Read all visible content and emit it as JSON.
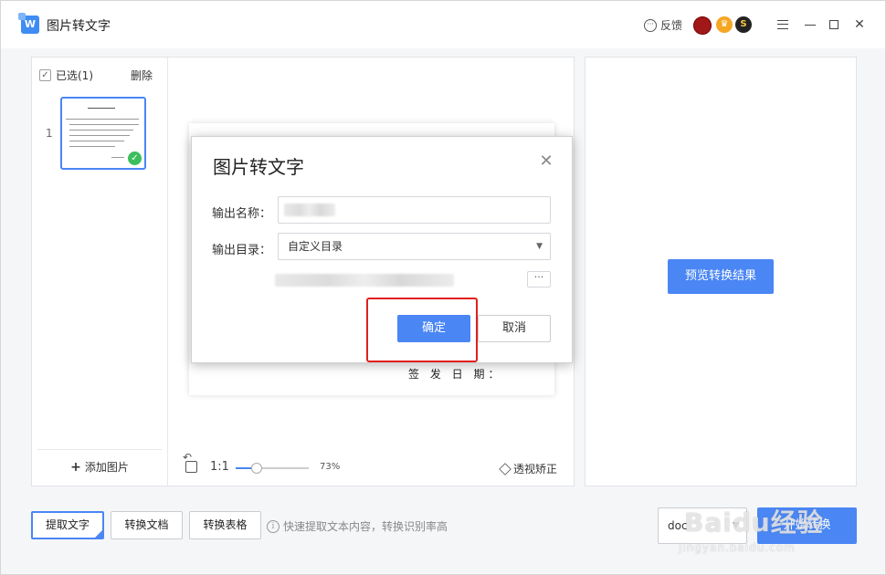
{
  "app": {
    "title": "图片转文字",
    "logo_text": "W"
  },
  "header": {
    "feedback_label": "反馈",
    "badge_s": "S",
    "colors": {
      "accent": "#4a86f4",
      "avatar": "#a01818",
      "crown": "#f5a623",
      "success": "#3bbf5c",
      "highlight": "#e0201e"
    }
  },
  "sidebar": {
    "select_all_label": "已选(1)",
    "delete_label": "删除",
    "thumbnail_index": "1",
    "add_image_label": "添加图片"
  },
  "preview": {
    "doc_sign_text": "签 发 日 期：",
    "ratio_label": "1:1",
    "zoom_value": "73%",
    "zoom_fraction": 0.29,
    "perspective_label": "透视矫正"
  },
  "right_panel": {
    "preview_result_label": "预览转换结果"
  },
  "bottom": {
    "extract_text_label": "提取文字",
    "convert_doc_label": "转换文档",
    "convert_table_label": "转换表格",
    "hint_text": "快速提取文本内容，转换识别率高",
    "format_value": "doc",
    "start_label": "开始转换"
  },
  "watermark": {
    "brand": "Baidu经验",
    "url": "jingyan.baidu.com"
  },
  "dialog": {
    "title": "图片转文字",
    "output_name_label": "输出名称：",
    "output_dir_label": "输出目录：",
    "output_dir_value": "自定义目录",
    "more_label": "···",
    "confirm_label": "确定",
    "cancel_label": "取消"
  }
}
